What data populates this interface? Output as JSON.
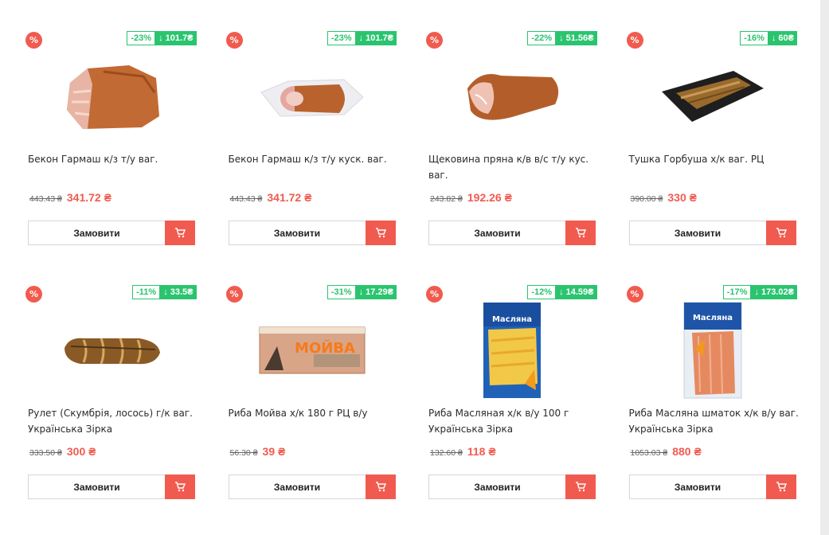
{
  "products": [
    {
      "name": "Бекон Гармаш к/з т/у ваг.",
      "old_price": "443.43 ₴",
      "new_price": "341.72 ₴",
      "discount_pct": "-23%",
      "savings": "↓ 101.7₴",
      "promo_icon": "%",
      "order_label": "Замовити",
      "image": "bacon-slab",
      "cart_icon": "cart-icon"
    },
    {
      "name": "Бекон Гармаш к/з т/у куск. ваг.",
      "old_price": "443.43 ₴",
      "new_price": "341.72 ₴",
      "discount_pct": "-23%",
      "savings": "↓ 101.7₴",
      "promo_icon": "%",
      "order_label": "Замовити",
      "image": "bacon-roll-packed",
      "cart_icon": "cart-icon"
    },
    {
      "name": "Щековина пряна к/в в/с т/у кус. ваг.",
      "old_price": "243.82 ₴",
      "new_price": "192.26 ₴",
      "discount_pct": "-22%",
      "savings": "↓ 51.56₴",
      "promo_icon": "%",
      "order_label": "Замовити",
      "image": "pork-cheek",
      "cart_icon": "cart-icon"
    },
    {
      "name": "Тушка Горбуша х/к ваг. РЦ",
      "old_price": "390.00 ₴",
      "new_price": "330 ₴",
      "discount_pct": "-16%",
      "savings": "↓ 60₴",
      "promo_icon": "%",
      "order_label": "Замовити",
      "image": "smoked-salmon-tray",
      "cart_icon": "cart-icon"
    },
    {
      "name": "Рулет (Скумбрія, лосось) г/к ваг. Українська Зірка",
      "old_price": "333.50 ₴",
      "new_price": "300 ₴",
      "discount_pct": "-11%",
      "savings": "↓ 33.5₴",
      "promo_icon": "%",
      "order_label": "Замовити",
      "image": "fish-roll",
      "cart_icon": "cart-icon"
    },
    {
      "name": "Риба Мойва х/к 180 г РЦ в/у",
      "old_price": "56.30 ₴",
      "new_price": "39 ₴",
      "discount_pct": "-31%",
      "savings": "↓ 17.29₴",
      "promo_icon": "%",
      "order_label": "Замовити",
      "image": "capelin-pack",
      "package_text": "МОЙВА",
      "cart_icon": "cart-icon"
    },
    {
      "name": "Риба Масляная х/к в/у 100 г Українська Зірка",
      "old_price": "132.60 ₴",
      "new_price": "118 ₴",
      "discount_pct": "-12%",
      "savings": "↓ 14.59₴",
      "promo_icon": "%",
      "order_label": "Замовити",
      "image": "butterfish-pack",
      "package_text": "Масляна",
      "cart_icon": "cart-icon"
    },
    {
      "name": "Риба Масляна шматок х/к в/у ваг. Українська Зірка",
      "old_price": "1053.03 ₴",
      "new_price": "880 ₴",
      "discount_pct": "-17%",
      "savings": "↓ 173.02₴",
      "promo_icon": "%",
      "order_label": "Замовити",
      "image": "butterfish-piece-pack",
      "package_text": "Масляна",
      "cart_icon": "cart-icon"
    }
  ],
  "colors": {
    "accent": "#f15b4f",
    "discount_green": "#2ac46f",
    "text": "#2b2b2b"
  }
}
